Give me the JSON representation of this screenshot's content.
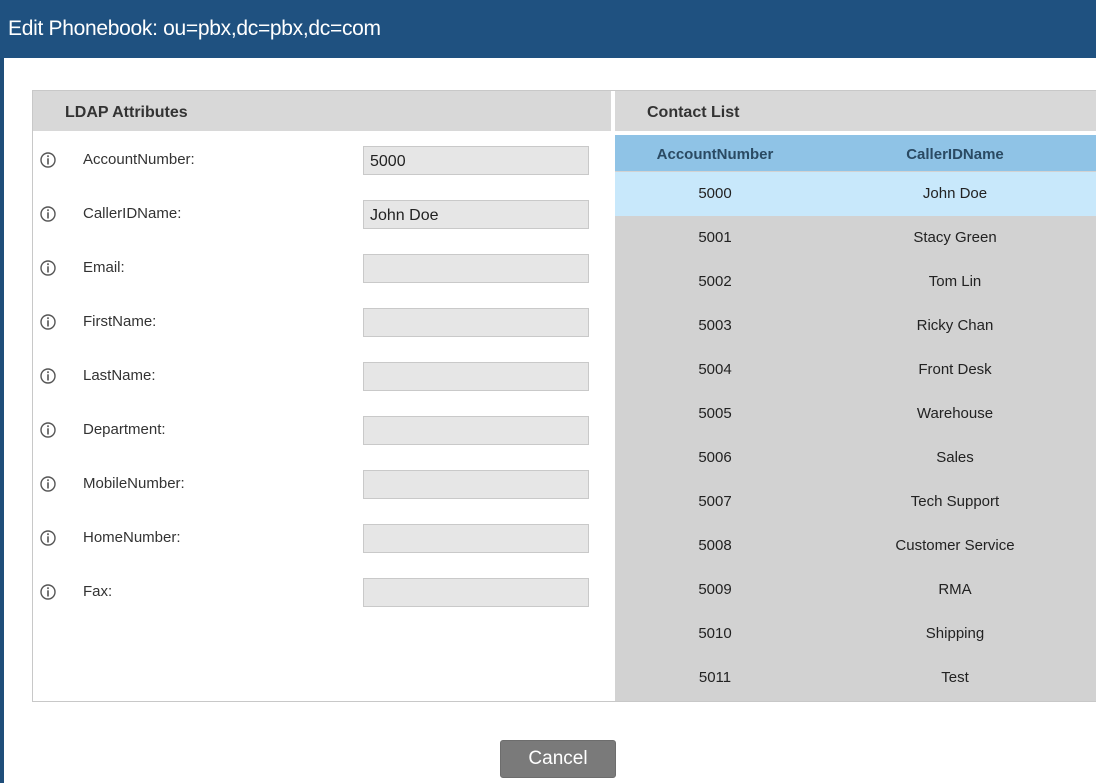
{
  "dialog": {
    "title": "Edit Phonebook: ou=pbx,dc=pbx,dc=com"
  },
  "ldap_attributes": {
    "header": "LDAP Attributes",
    "fields": [
      {
        "label": "AccountNumber:",
        "value": "5000"
      },
      {
        "label": "CallerIDName:",
        "value": "John Doe"
      },
      {
        "label": "Email:",
        "value": ""
      },
      {
        "label": "FirstName:",
        "value": ""
      },
      {
        "label": "LastName:",
        "value": ""
      },
      {
        "label": "Department:",
        "value": ""
      },
      {
        "label": "MobileNumber:",
        "value": ""
      },
      {
        "label": "HomeNumber:",
        "value": ""
      },
      {
        "label": "Fax:",
        "value": ""
      }
    ]
  },
  "contact_list": {
    "header": "Contact List",
    "columns": [
      "AccountNumber",
      "CallerIDName"
    ],
    "selected_index": 0,
    "rows": [
      {
        "account": "5000",
        "name": "John Doe"
      },
      {
        "account": "5001",
        "name": "Stacy Green"
      },
      {
        "account": "5002",
        "name": "Tom Lin"
      },
      {
        "account": "5003",
        "name": "Ricky Chan"
      },
      {
        "account": "5004",
        "name": "Front Desk"
      },
      {
        "account": "5005",
        "name": "Warehouse"
      },
      {
        "account": "5006",
        "name": "Sales"
      },
      {
        "account": "5007",
        "name": "Tech Support"
      },
      {
        "account": "5008",
        "name": "Customer Service"
      },
      {
        "account": "5009",
        "name": "RMA"
      },
      {
        "account": "5010",
        "name": "Shipping"
      },
      {
        "account": "5011",
        "name": "Test"
      }
    ]
  },
  "buttons": {
    "cancel": "Cancel"
  },
  "icons": {
    "field_info": "info-icon"
  },
  "colors": {
    "titlebar": "#1f5180",
    "table_header": "#8fc3e6",
    "selected_row": "#c8e8fb"
  }
}
